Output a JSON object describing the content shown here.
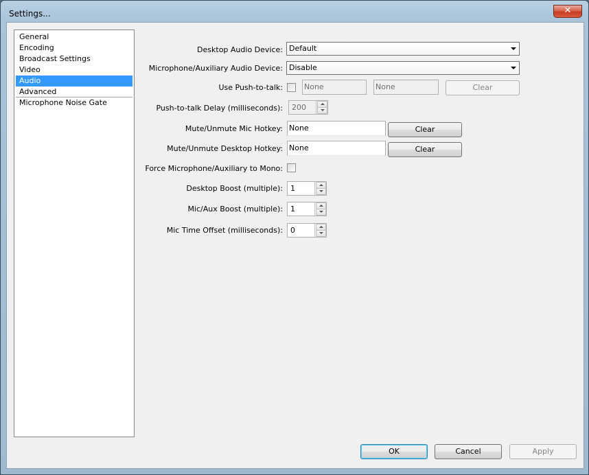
{
  "window": {
    "title": "Settings...",
    "close_glyph": "✕"
  },
  "nav": {
    "items": [
      {
        "label": "General"
      },
      {
        "label": "Encoding"
      },
      {
        "label": "Broadcast Settings"
      },
      {
        "label": "Video"
      },
      {
        "label": "Audio",
        "selected": true
      },
      {
        "label": "Advanced"
      },
      {
        "label": "Microphone Noise Gate"
      }
    ]
  },
  "audio": {
    "desktop_device": {
      "label": "Desktop Audio Device:",
      "value": "Default"
    },
    "mic_device": {
      "label": "Microphone/Auxiliary Audio Device:",
      "value": "Disable"
    },
    "push_to_talk": {
      "label": "Use Push-to-talk:",
      "checked": false,
      "hotkey1": "None",
      "hotkey2": "None",
      "clear_label": "Clear"
    },
    "ptt_delay": {
      "label": "Push-to-talk Delay (milliseconds):",
      "value": "200"
    },
    "mute_mic": {
      "label": "Mute/Unmute Mic Hotkey:",
      "value": "None",
      "clear_label": "Clear"
    },
    "mute_desktop": {
      "label": "Mute/Unmute Desktop Hotkey:",
      "value": "None",
      "clear_label": "Clear"
    },
    "force_mono": {
      "label": "Force Microphone/Auxiliary to Mono:",
      "checked": false
    },
    "desktop_boost": {
      "label": "Desktop Boost (multiple):",
      "value": "1"
    },
    "mic_boost": {
      "label": "Mic/Aux Boost (multiple):",
      "value": "1"
    },
    "mic_offset": {
      "label": "Mic Time Offset (milliseconds):",
      "value": "0"
    }
  },
  "footer": {
    "ok_label": "OK",
    "cancel_label": "Cancel",
    "apply_label": "Apply"
  },
  "colors": {
    "selection": "#3399ff",
    "close": "#c63b22"
  }
}
